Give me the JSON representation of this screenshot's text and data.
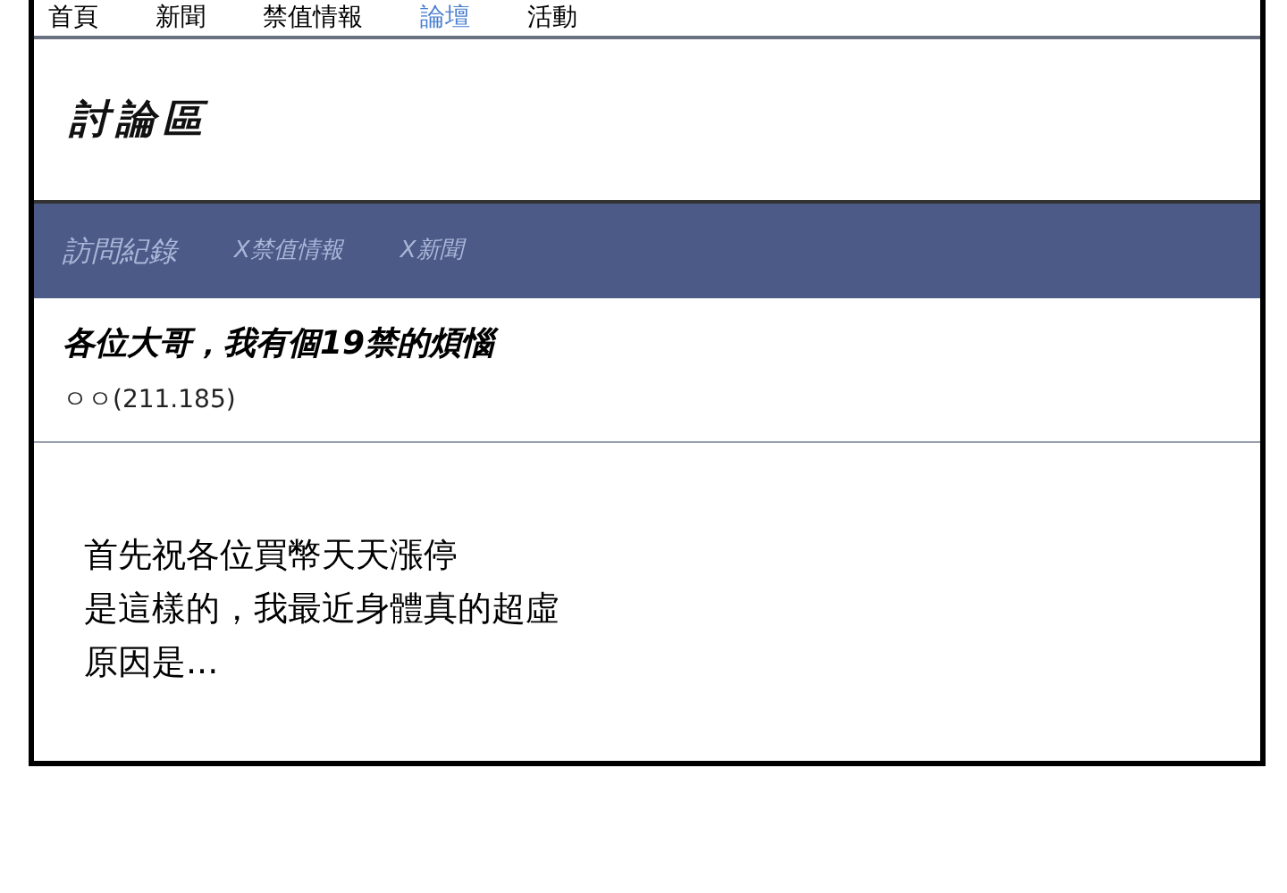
{
  "nav": [
    {
      "label": "首頁",
      "selected": false
    },
    {
      "label": "新聞",
      "selected": false
    },
    {
      "label": "禁值情報",
      "selected": false
    },
    {
      "label": "論壇",
      "selected": true
    },
    {
      "label": "活動",
      "selected": false
    }
  ],
  "section_title": "討論區",
  "tabs": [
    {
      "label": "訪問紀錄"
    },
    {
      "label": "X禁值情報"
    },
    {
      "label": "X新聞"
    }
  ],
  "post": {
    "title": "各位大哥，我有個19禁的煩惱",
    "author": "ㅇㅇ(211.185)",
    "body": [
      "首先祝各位買幣天天漲停",
      "是這樣的，我最近身體真的超虛",
      "原因是..."
    ]
  }
}
